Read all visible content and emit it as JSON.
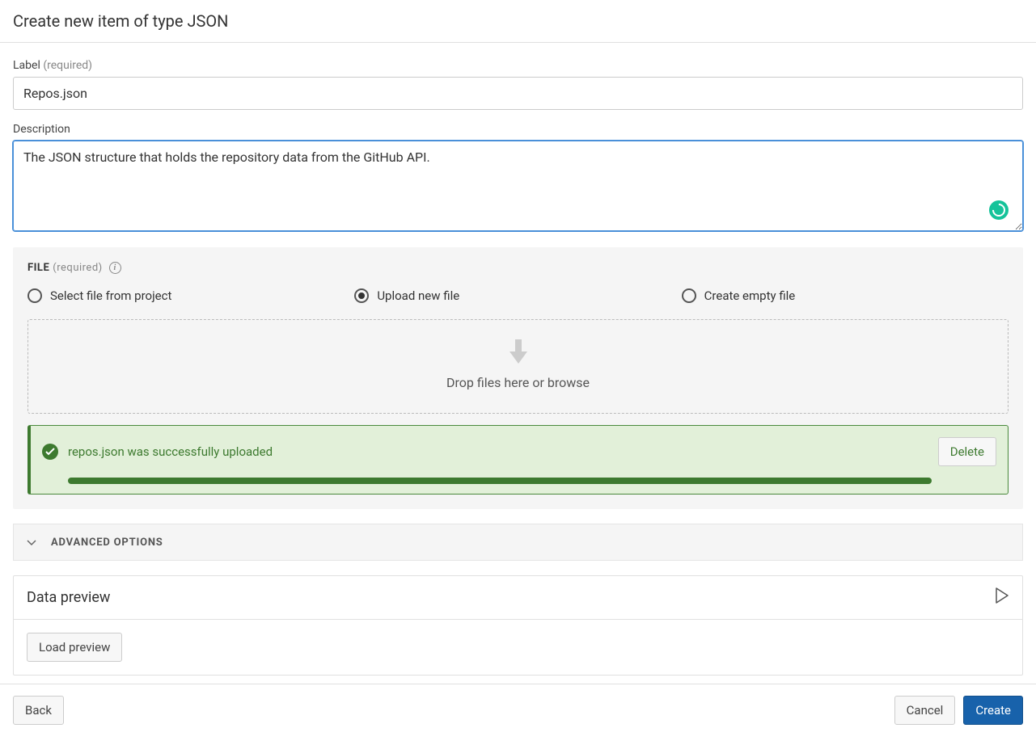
{
  "title": "Create new item of type JSON",
  "label_field": {
    "label": "Label",
    "required": "(required)",
    "value": "Repos.json"
  },
  "desc_field": {
    "label": "Description",
    "value": "The JSON structure that holds the repository data from the GitHub API."
  },
  "file_section": {
    "heading": "FILE",
    "required": "(required)",
    "options": {
      "select": "Select file from project",
      "upload": "Upload new file",
      "empty": "Create empty file"
    },
    "drop_text": "Drop files here or browse",
    "success_msg": "repos.json was successfully uploaded",
    "delete": "Delete"
  },
  "advanced": "ADVANCED OPTIONS",
  "preview": {
    "title": "Data preview",
    "load": "Load preview"
  },
  "footer": {
    "back": "Back",
    "cancel": "Cancel",
    "create": "Create"
  }
}
